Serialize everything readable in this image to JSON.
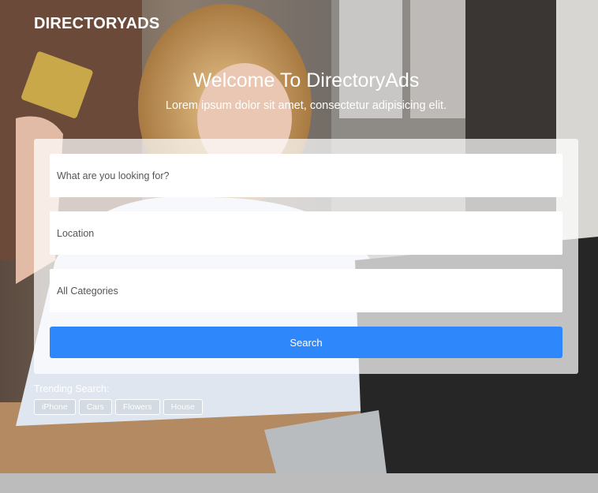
{
  "brand": {
    "logo_text": "DIRECTORYADS"
  },
  "hero": {
    "title": "Welcome To DirectoryAds",
    "subtitle": "Lorem ipsum dolor sit amet, consectetur adipisicing elit."
  },
  "search": {
    "keyword_placeholder": "What are you looking for?",
    "location_placeholder": "Location",
    "category_selected": "All Categories",
    "button_label": "Search"
  },
  "trending": {
    "label": "Trending Search:",
    "tags": [
      "iPhone",
      "Cars",
      "Flowers",
      "House"
    ]
  },
  "colors": {
    "accent": "#2f88fb",
    "footer_band": "#bcbcbc"
  }
}
